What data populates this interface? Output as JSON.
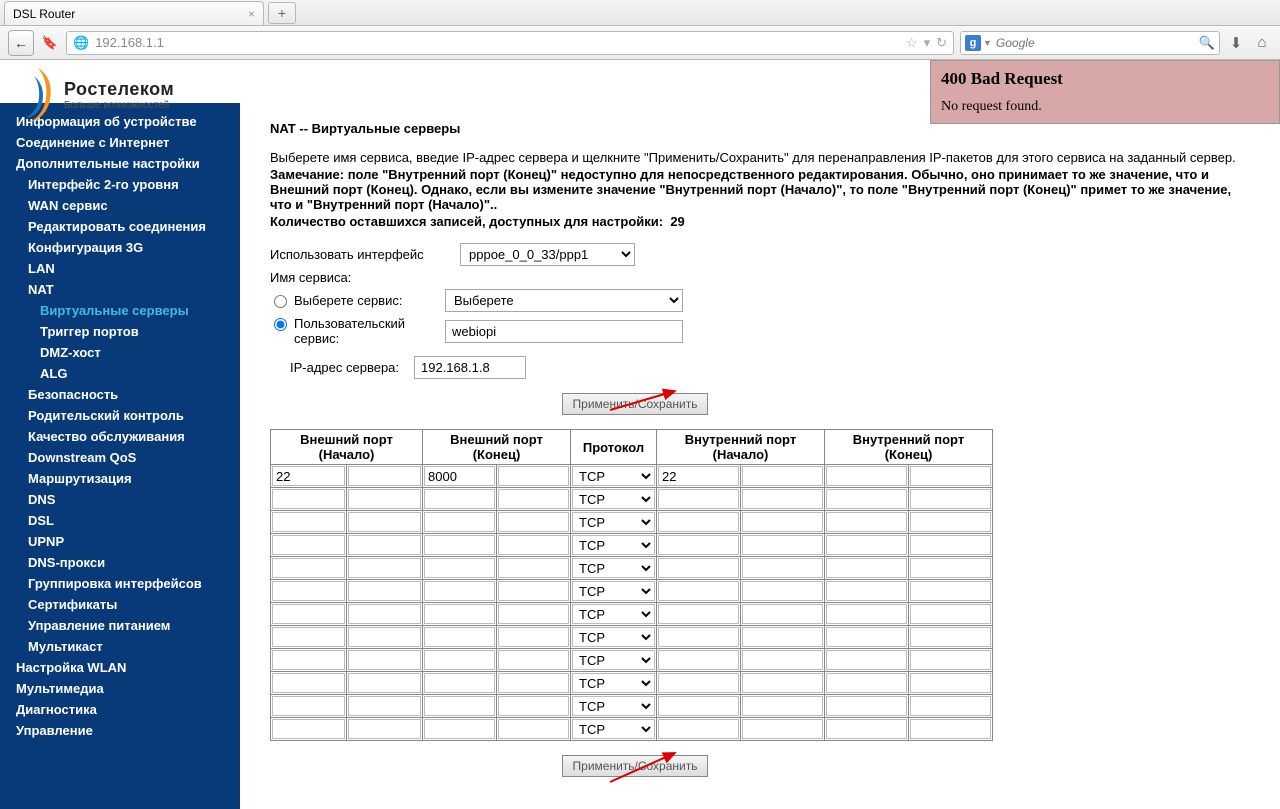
{
  "browser": {
    "tab_title": "DSL Router",
    "url": "192.168.1.1",
    "search_placeholder": "Google"
  },
  "logo": {
    "name": "Ростелеком",
    "tagline": "Больше возможностей"
  },
  "error": {
    "title": "400 Bad Request",
    "message": "No request found."
  },
  "sidebar": {
    "device_info": "Информация об устройстве",
    "internet": "Соединение с Интернет",
    "advanced": "Дополнительные настройки",
    "l2": "Интерфейс 2-го уровня",
    "wan": "WAN сервис",
    "edit_conn": "Редактировать соединения",
    "conf3g": "Конфигурация 3G",
    "lan": "LAN",
    "nat": "NAT",
    "virt": "Виртуальные серверы",
    "trigger": "Триггер портов",
    "dmz": "DMZ-хост",
    "alg": "ALG",
    "security": "Безопасность",
    "parental": "Родительский контроль",
    "qos": "Качество обслуживания",
    "dqos": "Downstream QoS",
    "routing": "Маршрутизация",
    "dns": "DNS",
    "dsl": "DSL",
    "upnp": "UPNP",
    "dnsproxy": "DNS-прокси",
    "ifgroup": "Группировка интерфейсов",
    "cert": "Сертификаты",
    "power": "Управление питанием",
    "multicast": "Мультикаст",
    "wlan": "Настройка WLAN",
    "multimedia": "Мультимедиа",
    "diag": "Диагностика",
    "manage": "Управление"
  },
  "main": {
    "title": "NAT -- Виртуальные серверы",
    "desc1": "Выберете имя сервиса, введие IP-адрес сервера и щелкните \"Применить/Сохранить\" для перенаправления IP-пакетов для этого сервиса на заданный сервер.",
    "desc2": "Замечание: поле \"Внутренний порт (Конец)\" недоступно для непосредственного редактирования. Обычно, оно принимает то же значение, что и Внешний порт (Конец). Однако, если вы измените значение \"Внутренний порт (Начало)\", то поле \"Внутренний порт (Конец)\" примет то же значение, что и \"Внутренний порт (Начало)\"..",
    "remaining_label": "Количество оставшихся записей, доступных для настройки:",
    "remaining_value": "29",
    "use_iface_label": "Использовать интерфейс",
    "iface_value": "pppoe_0_0_33/ppp1",
    "service_name_label": "Имя сервиса:",
    "select_service_label": "Выберете сервис:",
    "select_service_value": "Выберете",
    "custom_service_label": "Пользовательский сервис:",
    "custom_service_value": "webiopi",
    "ip_label": "IP-адрес сервера:",
    "ip_value": "192.168.1.8",
    "apply_btn": "Применить/Сохранить",
    "table": {
      "headers": {
        "ext_start": "Внешний порт (Начало)",
        "ext_end": "Внешний порт (Конец)",
        "protocol": "Протокол",
        "int_start": "Внутренний порт (Начало)",
        "int_end": "Внутренний порт (Конец)"
      },
      "protocol_option": "TCP",
      "rows": [
        {
          "ext_start": "22",
          "ext_end": "8000",
          "int_start": "22",
          "int_end": ""
        },
        {
          "ext_start": "",
          "ext_end": "",
          "int_start": "",
          "int_end": ""
        },
        {
          "ext_start": "",
          "ext_end": "",
          "int_start": "",
          "int_end": ""
        },
        {
          "ext_start": "",
          "ext_end": "",
          "int_start": "",
          "int_end": ""
        },
        {
          "ext_start": "",
          "ext_end": "",
          "int_start": "",
          "int_end": ""
        },
        {
          "ext_start": "",
          "ext_end": "",
          "int_start": "",
          "int_end": ""
        },
        {
          "ext_start": "",
          "ext_end": "",
          "int_start": "",
          "int_end": ""
        },
        {
          "ext_start": "",
          "ext_end": "",
          "int_start": "",
          "int_end": ""
        },
        {
          "ext_start": "",
          "ext_end": "",
          "int_start": "",
          "int_end": ""
        },
        {
          "ext_start": "",
          "ext_end": "",
          "int_start": "",
          "int_end": ""
        },
        {
          "ext_start": "",
          "ext_end": "",
          "int_start": "",
          "int_end": ""
        },
        {
          "ext_start": "",
          "ext_end": "",
          "int_start": "",
          "int_end": ""
        }
      ]
    }
  }
}
